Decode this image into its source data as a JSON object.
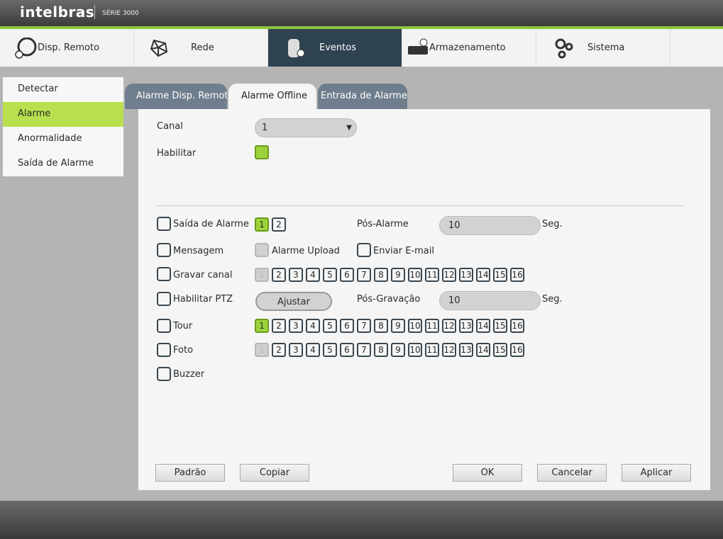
{
  "header": {
    "brand": "intelbras",
    "series": "SÉRIE 3000"
  },
  "nav": [
    {
      "label": "Disp. Remoto",
      "icon": "remote-device-icon"
    },
    {
      "label": "Rede",
      "icon": "network-icon"
    },
    {
      "label": "Eventos",
      "icon": "events-icon",
      "active": true
    },
    {
      "label": "Armazenamento",
      "icon": "storage-icon"
    },
    {
      "label": "Sistema",
      "icon": "gears-icon"
    }
  ],
  "sidebar": [
    {
      "label": "Detectar"
    },
    {
      "label": "Alarme",
      "active": true
    },
    {
      "label": "Anormalidade"
    },
    {
      "label": "Saída de Alarme"
    }
  ],
  "tabs": [
    {
      "label": "Alarme Disp. Remoto"
    },
    {
      "label": "Alarme Offline",
      "active": true
    },
    {
      "label": "Entrada de Alarme"
    }
  ],
  "form": {
    "canal_label": "Canal",
    "canal_value": "1",
    "habilitar_label": "Habilitar",
    "habilitar_checked": true,
    "saida_label": "Saída de Alarme",
    "saida_outputs": [
      "1",
      "2"
    ],
    "saida_selected": [
      "1"
    ],
    "pos_alarme_label": "Pós-Alarme",
    "pos_alarme_value": "10",
    "seg1": "Seg.",
    "mensagem_label": "Mensagem",
    "upload_label": "Alarme Upload",
    "email_label": "Enviar E-mail",
    "gravar_label": "Gravar canal",
    "ptz_label": "Habilitar PTZ",
    "ajustar_label": "Ajustar",
    "pos_gravacao_label": "Pós-Gravação",
    "pos_gravacao_value": "10",
    "seg2": "Seg.",
    "tour_label": "Tour",
    "foto_label": "Foto",
    "buzzer_label": "Buzzer",
    "channels": [
      "1",
      "2",
      "3",
      "4",
      "5",
      "6",
      "7",
      "8",
      "9",
      "10",
      "11",
      "12",
      "13",
      "14",
      "15",
      "16"
    ]
  },
  "buttons": {
    "padrao": "Padrão",
    "copiar": "Copiar",
    "ok": "OK",
    "cancelar": "Cancelar",
    "aplicar": "Aplicar"
  },
  "colors": {
    "accent": "#9cd33a",
    "nav_active": "#2f4250"
  }
}
